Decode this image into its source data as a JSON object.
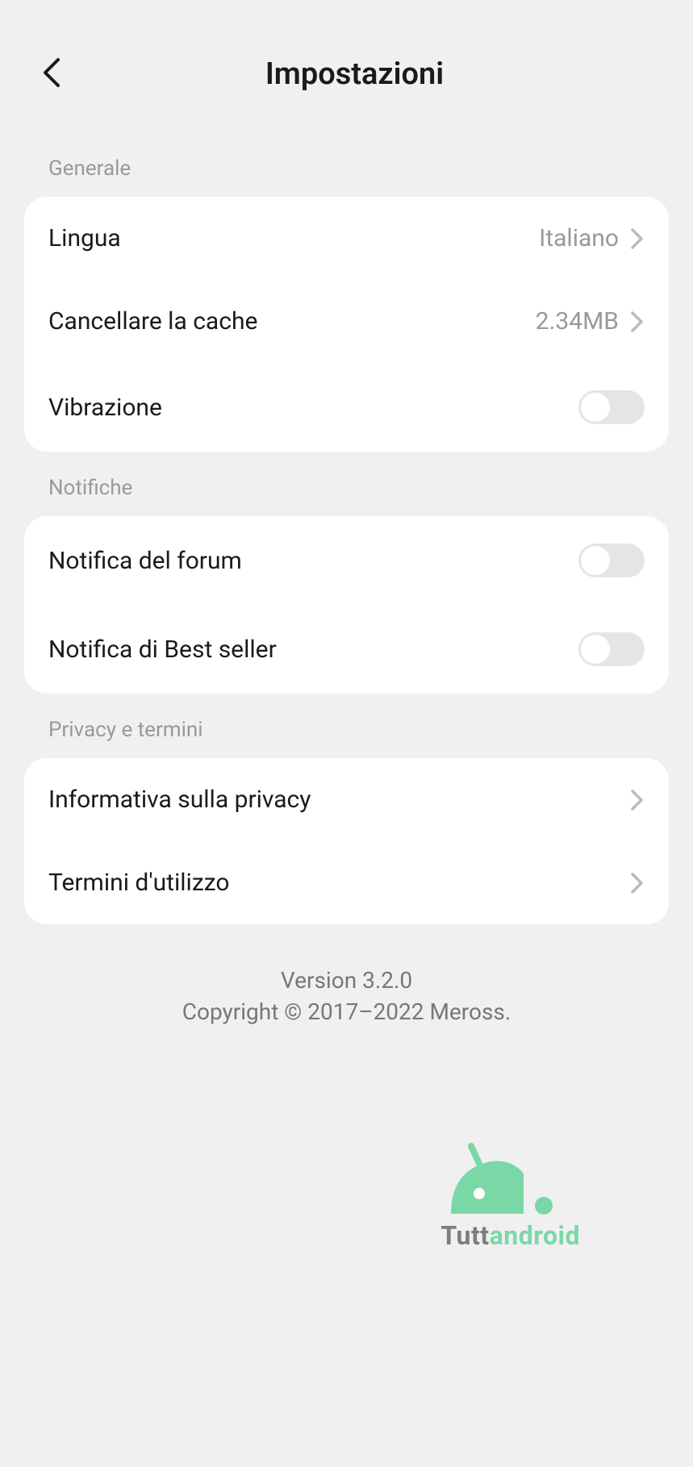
{
  "header": {
    "title": "Impostazioni"
  },
  "sections": {
    "general": {
      "title": "Generale",
      "language": {
        "label": "Lingua",
        "value": "Italiano"
      },
      "clearCache": {
        "label": "Cancellare la cache",
        "value": "2.34MB"
      },
      "vibration": {
        "label": "Vibrazione",
        "enabled": false
      }
    },
    "notifications": {
      "title": "Notifiche",
      "forum": {
        "label": "Notifica del forum",
        "enabled": false
      },
      "bestSeller": {
        "label": "Notifica di Best seller",
        "enabled": false
      }
    },
    "privacy": {
      "title": "Privacy e termini",
      "privacyPolicy": {
        "label": "Informativa sulla privacy"
      },
      "terms": {
        "label": "Termini d'utilizzo"
      }
    }
  },
  "footer": {
    "version": "Version 3.2.0",
    "copyright": "Copyright © 2017–2022 Meross."
  },
  "watermark": {
    "part1": "Tutt",
    "part2": "android"
  }
}
